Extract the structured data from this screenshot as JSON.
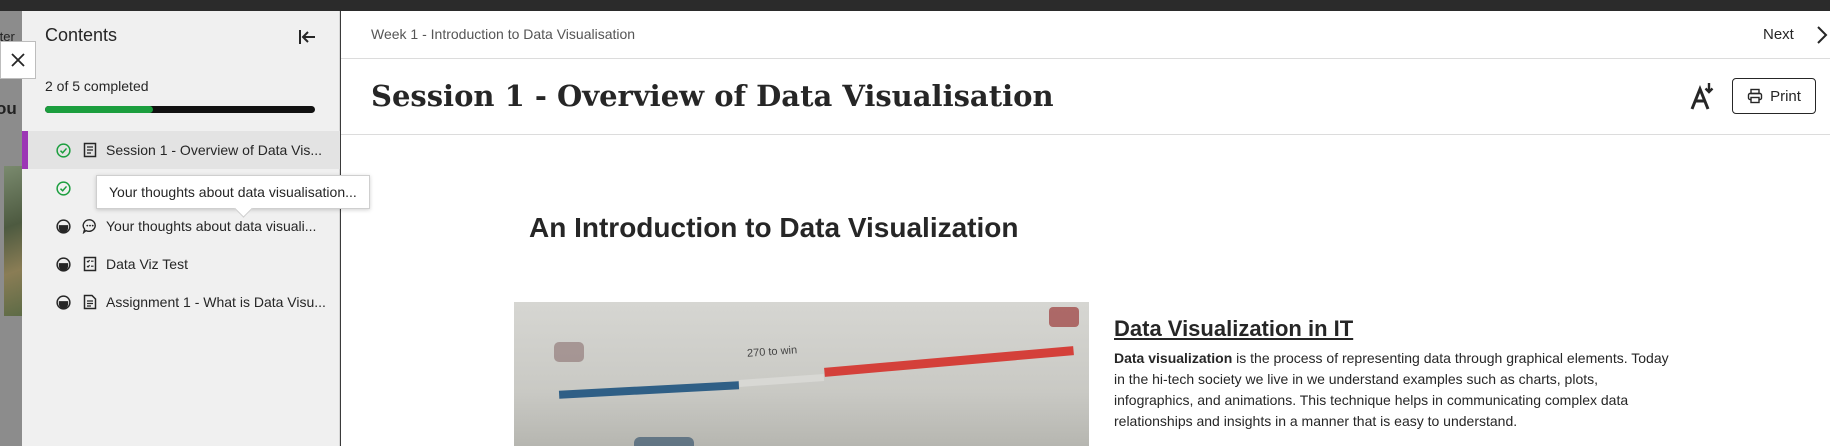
{
  "background": {
    "text_fragment_1": "tter",
    "text_fragment_2": "ou"
  },
  "sidebar": {
    "title": "Contents",
    "progress_text": "2 of 5 completed",
    "progress_fraction": 0.4,
    "items": [
      {
        "label": "Session 1 - Overview of Data Vis...",
        "status": "completed",
        "type": "document",
        "active": true
      },
      {
        "label": "",
        "status": "completed",
        "type": "document",
        "active": false
      },
      {
        "label": "Your thoughts about data visuali...",
        "status": "not-started",
        "type": "discussion",
        "active": false
      },
      {
        "label": "Data Viz Test",
        "status": "not-started",
        "type": "test",
        "active": false
      },
      {
        "label": "Assignment 1 - What is Data Visu...",
        "status": "not-started",
        "type": "assignment",
        "active": false
      }
    ],
    "tooltip": "Your thoughts about data visualisation..."
  },
  "header": {
    "breadcrumb": "Week 1 - Introduction to Data Visualisation",
    "next_label": "Next",
    "page_title": "Session 1 - Overview of Data Visualisation",
    "print_label": "Print"
  },
  "content": {
    "heading": "An Introduction to Data Visualization",
    "hero_caption": "270 to win",
    "side_heading": "Data Visualization in IT",
    "side_bold": "Data visualization",
    "side_text": " is the process of representing data through graphical elements. Today in the hi-tech society we live in we understand examples such as charts, plots, infographics, and animations. This technique helps in communicating complex data relationships and insights in a manner that is easy to understand."
  },
  "colors": {
    "accent_purple": "#9c36b5",
    "progress_green": "#1b9e3e",
    "completed_green": "#1b9e3e"
  }
}
